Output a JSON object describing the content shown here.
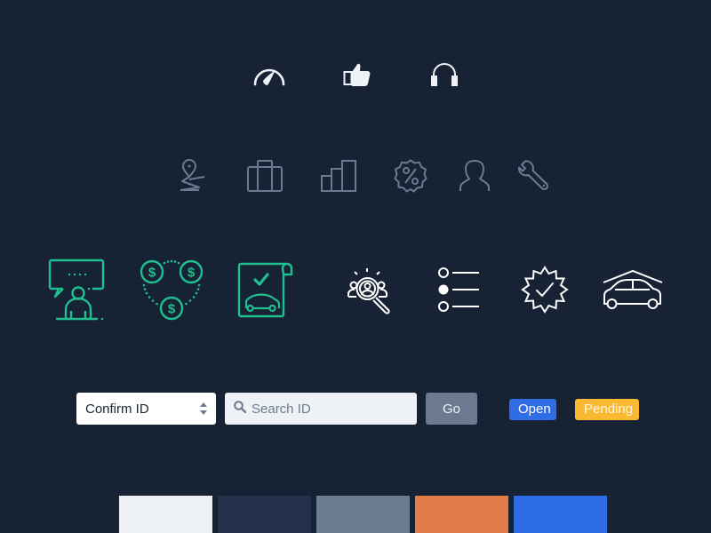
{
  "icon_rows": {
    "row1": {
      "color": "#eef2f7",
      "icons": [
        "speedometer-icon",
        "thumbs-up-icon",
        "headphones-icon"
      ]
    },
    "row2": {
      "color": "#6b7a90",
      "icons": [
        "map-pin-route-icon",
        "briefcase-icon",
        "bar-chart-icon",
        "discount-badge-icon",
        "user-icon",
        "wrench-icon"
      ]
    },
    "row3": {
      "green_color": "#1fbf8f",
      "white_color": "#ffffff",
      "icons": [
        "customer-support-chat-icon",
        "money-exchange-icon",
        "car-contract-icon",
        "talent-search-icon",
        "radio-list-icon",
        "verified-badge-icon",
        "car-garage-icon"
      ]
    }
  },
  "controls": {
    "select": {
      "value": "Confirm ID"
    },
    "search": {
      "placeholder": "Search ID",
      "value": ""
    },
    "go_label": "Go"
  },
  "badges": [
    {
      "label": "Open",
      "color": "#2f6de5"
    },
    {
      "label": "Pending",
      "color": "#fbb931"
    }
  ],
  "palette": [
    {
      "name": "light",
      "hex": "#edf1f5"
    },
    {
      "name": "navy",
      "hex": "#23324a"
    },
    {
      "name": "slate",
      "hex": "#6b7b90"
    },
    {
      "name": "orange",
      "hex": "#df7c48"
    },
    {
      "name": "blue",
      "hex": "#2f6de5"
    }
  ]
}
